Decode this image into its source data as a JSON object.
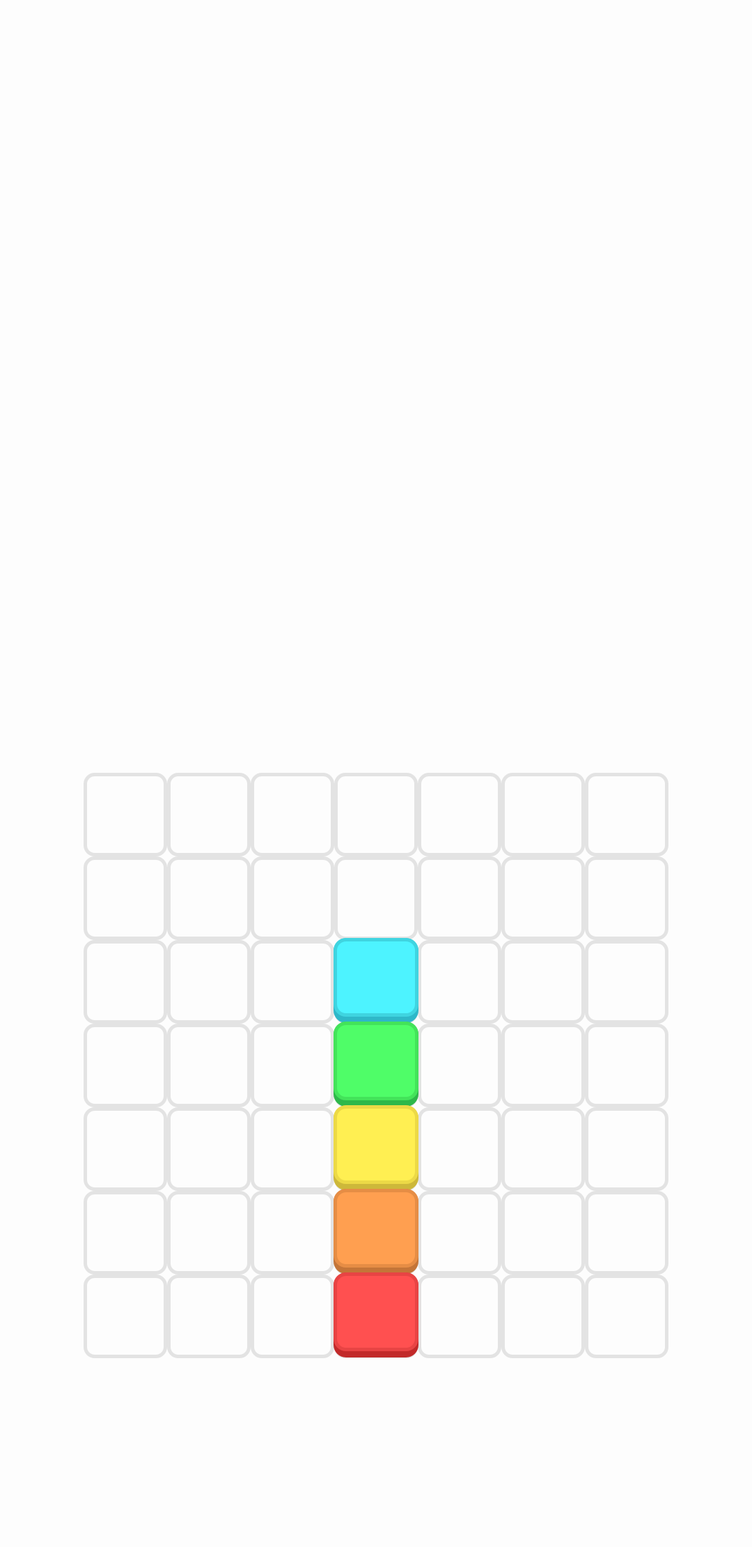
{
  "board": {
    "rows": 7,
    "columns": 7,
    "cell_border_color": "#e3e3e3",
    "background_color": "#fdfdfd"
  },
  "blocks": [
    {
      "color_name": "cyan",
      "row": 3,
      "column": 4,
      "face": "#4df3ff",
      "edge": "#3fd4e0",
      "shadow": "#2fb8c9"
    },
    {
      "color_name": "green",
      "row": 4,
      "column": 4,
      "face": "#4ffd68",
      "edge": "#43e35a",
      "shadow": "#2eb84a"
    },
    {
      "color_name": "yellow",
      "row": 5,
      "column": 4,
      "face": "#ffef52",
      "edge": "#ecd946",
      "shadow": "#cdb83a"
    },
    {
      "color_name": "orange",
      "row": 6,
      "column": 4,
      "face": "#ff9f50",
      "edge": "#e68d45",
      "shadow": "#c47538"
    },
    {
      "color_name": "red",
      "row": 7,
      "column": 4,
      "face": "#ff5050",
      "edge": "#e84444",
      "shadow": "#c22a2a"
    }
  ]
}
